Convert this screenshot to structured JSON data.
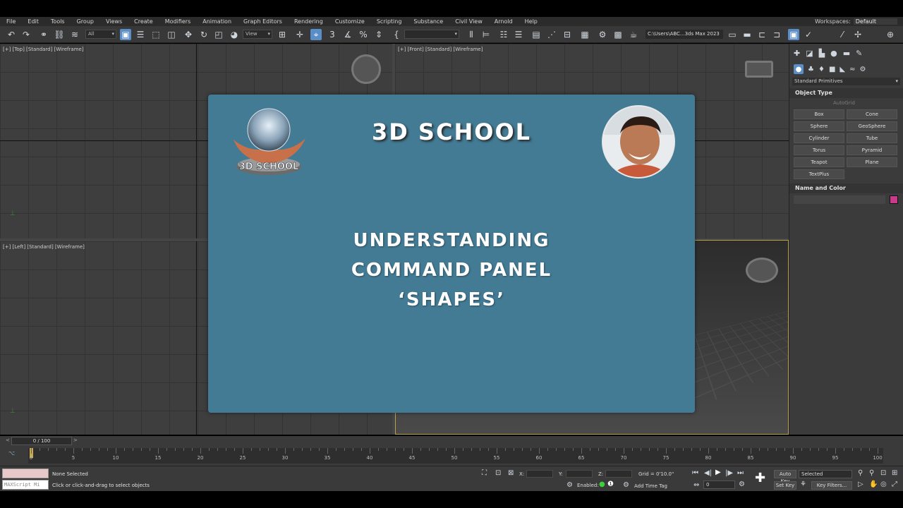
{
  "menu": {
    "items": [
      "File",
      "Edit",
      "Tools",
      "Group",
      "Views",
      "Create",
      "Modifiers",
      "Animation",
      "Graph Editors",
      "Rendering",
      "Customize",
      "Scripting",
      "Substance",
      "Civil View",
      "Arnold",
      "Help"
    ],
    "workspace_label": "Workspaces:",
    "workspace_value": "Default"
  },
  "toolbar": {
    "filter_value": "All",
    "ref_coord_value": "View",
    "project_path": "C:\\Users\\ABC...3ds Max 2023"
  },
  "viewports": {
    "top_label": "[+] [Top] [Standard] [Wireframe]",
    "front_label": "[+] [Front] [Standard] [Wireframe]",
    "left_label": "[+] [Left] [Standard] [Wireframe]"
  },
  "command_panel": {
    "category": "Standard Primitives",
    "object_type_title": "Object Type",
    "autogrid_label": "AutoGrid",
    "buttons": [
      "Box",
      "Cone",
      "Sphere",
      "GeoSphere",
      "Cylinder",
      "Tube",
      "Torus",
      "Pyramid",
      "Teapot",
      "Plane",
      "TextPlus"
    ],
    "name_color_title": "Name and Color",
    "object_color": "#c83a8a"
  },
  "timeline": {
    "slider_text": "0 / 100",
    "ticks": [
      "0",
      "5",
      "10",
      "15",
      "20",
      "25",
      "30",
      "35",
      "40",
      "45",
      "50",
      "55",
      "60",
      "65",
      "70",
      "75",
      "80",
      "85",
      "90",
      "95",
      "100"
    ]
  },
  "status": {
    "maxscript_placeholder": "MAXScript Mi",
    "selection": "None Selected",
    "prompt": "Click or click-and-drag to select objects",
    "x_label": "X:",
    "y_label": "Y:",
    "z_label": "Z:",
    "grid": "Grid = 0'10.0\"",
    "enabled_label": "Enabled:",
    "add_time_tag": "Add Time Tag",
    "frame_value": "0",
    "auto_key": "Auto Key",
    "set_key": "Set Key",
    "selected_value": "Selected",
    "key_filters": "Key Filters..."
  },
  "overlay": {
    "school_name": "3D SCHOOL",
    "title_line1": "UNDERSTANDING",
    "title_line2": "COMMAND PANEL",
    "title_line3": "‘SHAPES’",
    "logo_text": "3D SCHOOL",
    "card_color": "#437b94"
  }
}
